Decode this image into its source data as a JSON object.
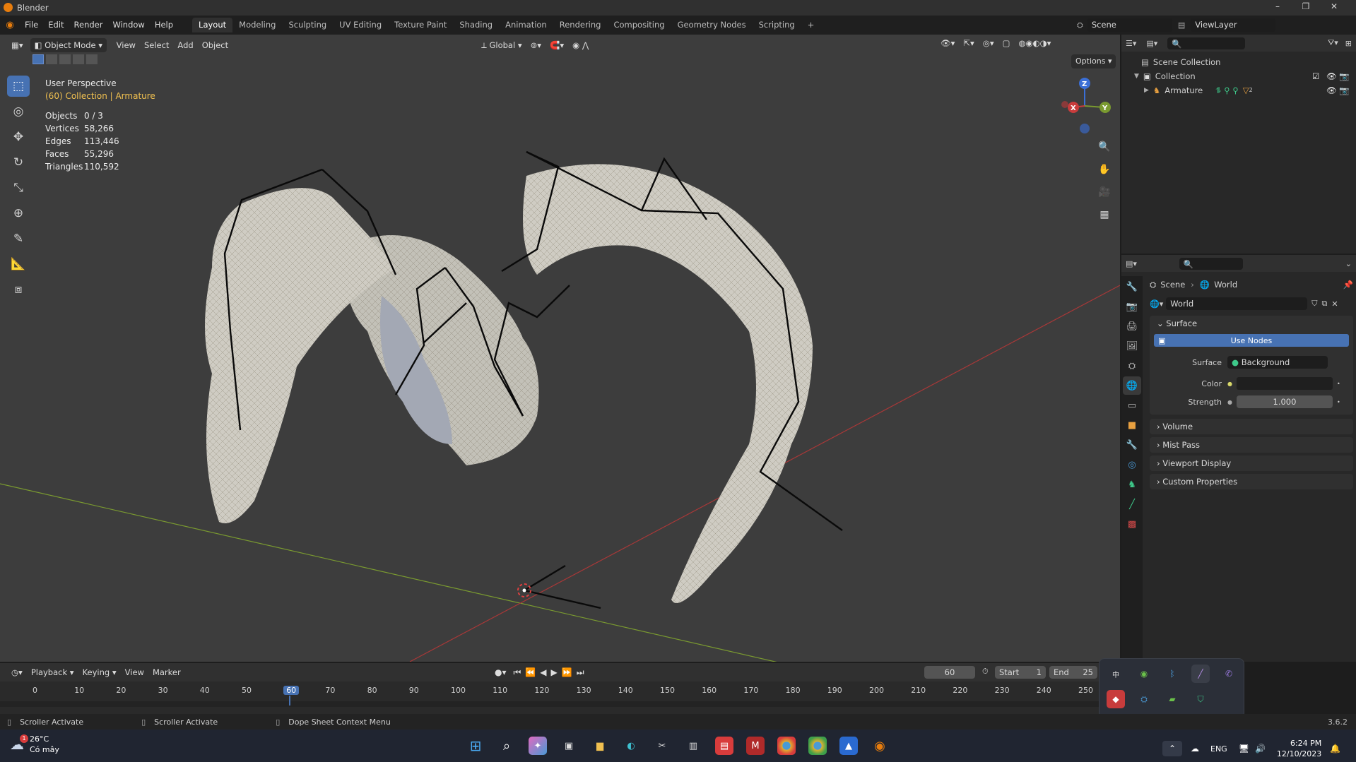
{
  "window": {
    "title": "Blender",
    "controls": [
      "–",
      "❐",
      "✕"
    ]
  },
  "menu": [
    "File",
    "Edit",
    "Render",
    "Window",
    "Help"
  ],
  "workspaces": [
    "Layout",
    "Modeling",
    "Sculpting",
    "UV Editing",
    "Texture Paint",
    "Shading",
    "Animation",
    "Rendering",
    "Compositing",
    "Geometry Nodes",
    "Scripting"
  ],
  "workspace_add": "+",
  "scene_field": "Scene",
  "viewlayer_field": "ViewLayer",
  "viewport": {
    "mode": "Object Mode",
    "menus": [
      "View",
      "Select",
      "Add",
      "Object"
    ],
    "transform_orientation": "Global",
    "options": "Options",
    "perspective": "User Perspective",
    "collection_line": "(60) Collection | Armature",
    "stats": [
      {
        "label": "Objects",
        "value": "0 / 3"
      },
      {
        "label": "Vertices",
        "value": "58,266"
      },
      {
        "label": "Edges",
        "value": "113,446"
      },
      {
        "label": "Faces",
        "value": "55,296"
      },
      {
        "label": "Triangles",
        "value": "110,592"
      }
    ],
    "gizmo": {
      "z": "Z",
      "y": "Y",
      "x": "X"
    }
  },
  "outliner": {
    "items": [
      {
        "label": "Scene Collection"
      },
      {
        "label": "Collection"
      },
      {
        "label": "Armature"
      }
    ],
    "armature_badge": "2"
  },
  "properties": {
    "breadcrumb_scene": "Scene",
    "breadcrumb_world": "World",
    "world_name": "World",
    "surface_header": "Surface",
    "use_nodes": "Use Nodes",
    "surface_label": "Surface",
    "surface_value": "Background",
    "color_label": "Color",
    "strength_label": "Strength",
    "strength_value": "1.000",
    "sections": [
      "Volume",
      "Mist Pass",
      "Viewport Display",
      "Custom Properties"
    ]
  },
  "timeline": {
    "menus": [
      "Playback",
      "Keying",
      "View",
      "Marker"
    ],
    "current_frame": "60",
    "start_label": "Start",
    "start_value": "1",
    "end_label": "End",
    "end_value": "25",
    "ticks": [
      "0",
      "10",
      "20",
      "30",
      "40",
      "50",
      "60",
      "70",
      "80",
      "90",
      "100",
      "110",
      "120",
      "130",
      "140",
      "150",
      "160",
      "170",
      "180",
      "190",
      "200",
      "210",
      "220",
      "230",
      "240",
      "250"
    ],
    "playhead": "60"
  },
  "status": {
    "items": [
      "Scroller Activate",
      "Scroller Activate",
      "Dope Sheet Context Menu"
    ],
    "version": "3.6.2"
  },
  "taskbar": {
    "weather_temp": "26°C",
    "weather_desc": "Có mây",
    "weather_badge": "1",
    "lang": "ENG",
    "time": "6:24 PM",
    "date": "12/10/2023"
  },
  "colors": {
    "accent": "#4772b3",
    "viewport_bg": "#3d3d3d",
    "collection_text": "#f0c050",
    "axis_x": "#c83c3c",
    "axis_y": "#7a9a30"
  }
}
